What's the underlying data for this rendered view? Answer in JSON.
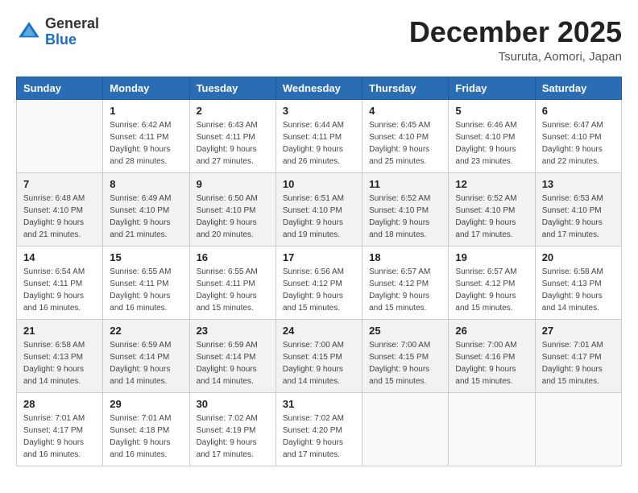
{
  "header": {
    "logo_general": "General",
    "logo_blue": "Blue",
    "month_title": "December 2025",
    "location": "Tsuruta, Aomori, Japan"
  },
  "days_of_week": [
    "Sunday",
    "Monday",
    "Tuesday",
    "Wednesday",
    "Thursday",
    "Friday",
    "Saturday"
  ],
  "weeks": [
    [
      {
        "day": "",
        "info": ""
      },
      {
        "day": "1",
        "info": "Sunrise: 6:42 AM\nSunset: 4:11 PM\nDaylight: 9 hours\nand 28 minutes."
      },
      {
        "day": "2",
        "info": "Sunrise: 6:43 AM\nSunset: 4:11 PM\nDaylight: 9 hours\nand 27 minutes."
      },
      {
        "day": "3",
        "info": "Sunrise: 6:44 AM\nSunset: 4:11 PM\nDaylight: 9 hours\nand 26 minutes."
      },
      {
        "day": "4",
        "info": "Sunrise: 6:45 AM\nSunset: 4:10 PM\nDaylight: 9 hours\nand 25 minutes."
      },
      {
        "day": "5",
        "info": "Sunrise: 6:46 AM\nSunset: 4:10 PM\nDaylight: 9 hours\nand 23 minutes."
      },
      {
        "day": "6",
        "info": "Sunrise: 6:47 AM\nSunset: 4:10 PM\nDaylight: 9 hours\nand 22 minutes."
      }
    ],
    [
      {
        "day": "7",
        "info": "Sunrise: 6:48 AM\nSunset: 4:10 PM\nDaylight: 9 hours\nand 21 minutes."
      },
      {
        "day": "8",
        "info": "Sunrise: 6:49 AM\nSunset: 4:10 PM\nDaylight: 9 hours\nand 21 minutes."
      },
      {
        "day": "9",
        "info": "Sunrise: 6:50 AM\nSunset: 4:10 PM\nDaylight: 9 hours\nand 20 minutes."
      },
      {
        "day": "10",
        "info": "Sunrise: 6:51 AM\nSunset: 4:10 PM\nDaylight: 9 hours\nand 19 minutes."
      },
      {
        "day": "11",
        "info": "Sunrise: 6:52 AM\nSunset: 4:10 PM\nDaylight: 9 hours\nand 18 minutes."
      },
      {
        "day": "12",
        "info": "Sunrise: 6:52 AM\nSunset: 4:10 PM\nDaylight: 9 hours\nand 17 minutes."
      },
      {
        "day": "13",
        "info": "Sunrise: 6:53 AM\nSunset: 4:10 PM\nDaylight: 9 hours\nand 17 minutes."
      }
    ],
    [
      {
        "day": "14",
        "info": "Sunrise: 6:54 AM\nSunset: 4:11 PM\nDaylight: 9 hours\nand 16 minutes."
      },
      {
        "day": "15",
        "info": "Sunrise: 6:55 AM\nSunset: 4:11 PM\nDaylight: 9 hours\nand 16 minutes."
      },
      {
        "day": "16",
        "info": "Sunrise: 6:55 AM\nSunset: 4:11 PM\nDaylight: 9 hours\nand 15 minutes."
      },
      {
        "day": "17",
        "info": "Sunrise: 6:56 AM\nSunset: 4:12 PM\nDaylight: 9 hours\nand 15 minutes."
      },
      {
        "day": "18",
        "info": "Sunrise: 6:57 AM\nSunset: 4:12 PM\nDaylight: 9 hours\nand 15 minutes."
      },
      {
        "day": "19",
        "info": "Sunrise: 6:57 AM\nSunset: 4:12 PM\nDaylight: 9 hours\nand 15 minutes."
      },
      {
        "day": "20",
        "info": "Sunrise: 6:58 AM\nSunset: 4:13 PM\nDaylight: 9 hours\nand 14 minutes."
      }
    ],
    [
      {
        "day": "21",
        "info": "Sunrise: 6:58 AM\nSunset: 4:13 PM\nDaylight: 9 hours\nand 14 minutes."
      },
      {
        "day": "22",
        "info": "Sunrise: 6:59 AM\nSunset: 4:14 PM\nDaylight: 9 hours\nand 14 minutes."
      },
      {
        "day": "23",
        "info": "Sunrise: 6:59 AM\nSunset: 4:14 PM\nDaylight: 9 hours\nand 14 minutes."
      },
      {
        "day": "24",
        "info": "Sunrise: 7:00 AM\nSunset: 4:15 PM\nDaylight: 9 hours\nand 14 minutes."
      },
      {
        "day": "25",
        "info": "Sunrise: 7:00 AM\nSunset: 4:15 PM\nDaylight: 9 hours\nand 15 minutes."
      },
      {
        "day": "26",
        "info": "Sunrise: 7:00 AM\nSunset: 4:16 PM\nDaylight: 9 hours\nand 15 minutes."
      },
      {
        "day": "27",
        "info": "Sunrise: 7:01 AM\nSunset: 4:17 PM\nDaylight: 9 hours\nand 15 minutes."
      }
    ],
    [
      {
        "day": "28",
        "info": "Sunrise: 7:01 AM\nSunset: 4:17 PM\nDaylight: 9 hours\nand 16 minutes."
      },
      {
        "day": "29",
        "info": "Sunrise: 7:01 AM\nSunset: 4:18 PM\nDaylight: 9 hours\nand 16 minutes."
      },
      {
        "day": "30",
        "info": "Sunrise: 7:02 AM\nSunset: 4:19 PM\nDaylight: 9 hours\nand 17 minutes."
      },
      {
        "day": "31",
        "info": "Sunrise: 7:02 AM\nSunset: 4:20 PM\nDaylight: 9 hours\nand 17 minutes."
      },
      {
        "day": "",
        "info": ""
      },
      {
        "day": "",
        "info": ""
      },
      {
        "day": "",
        "info": ""
      }
    ]
  ]
}
